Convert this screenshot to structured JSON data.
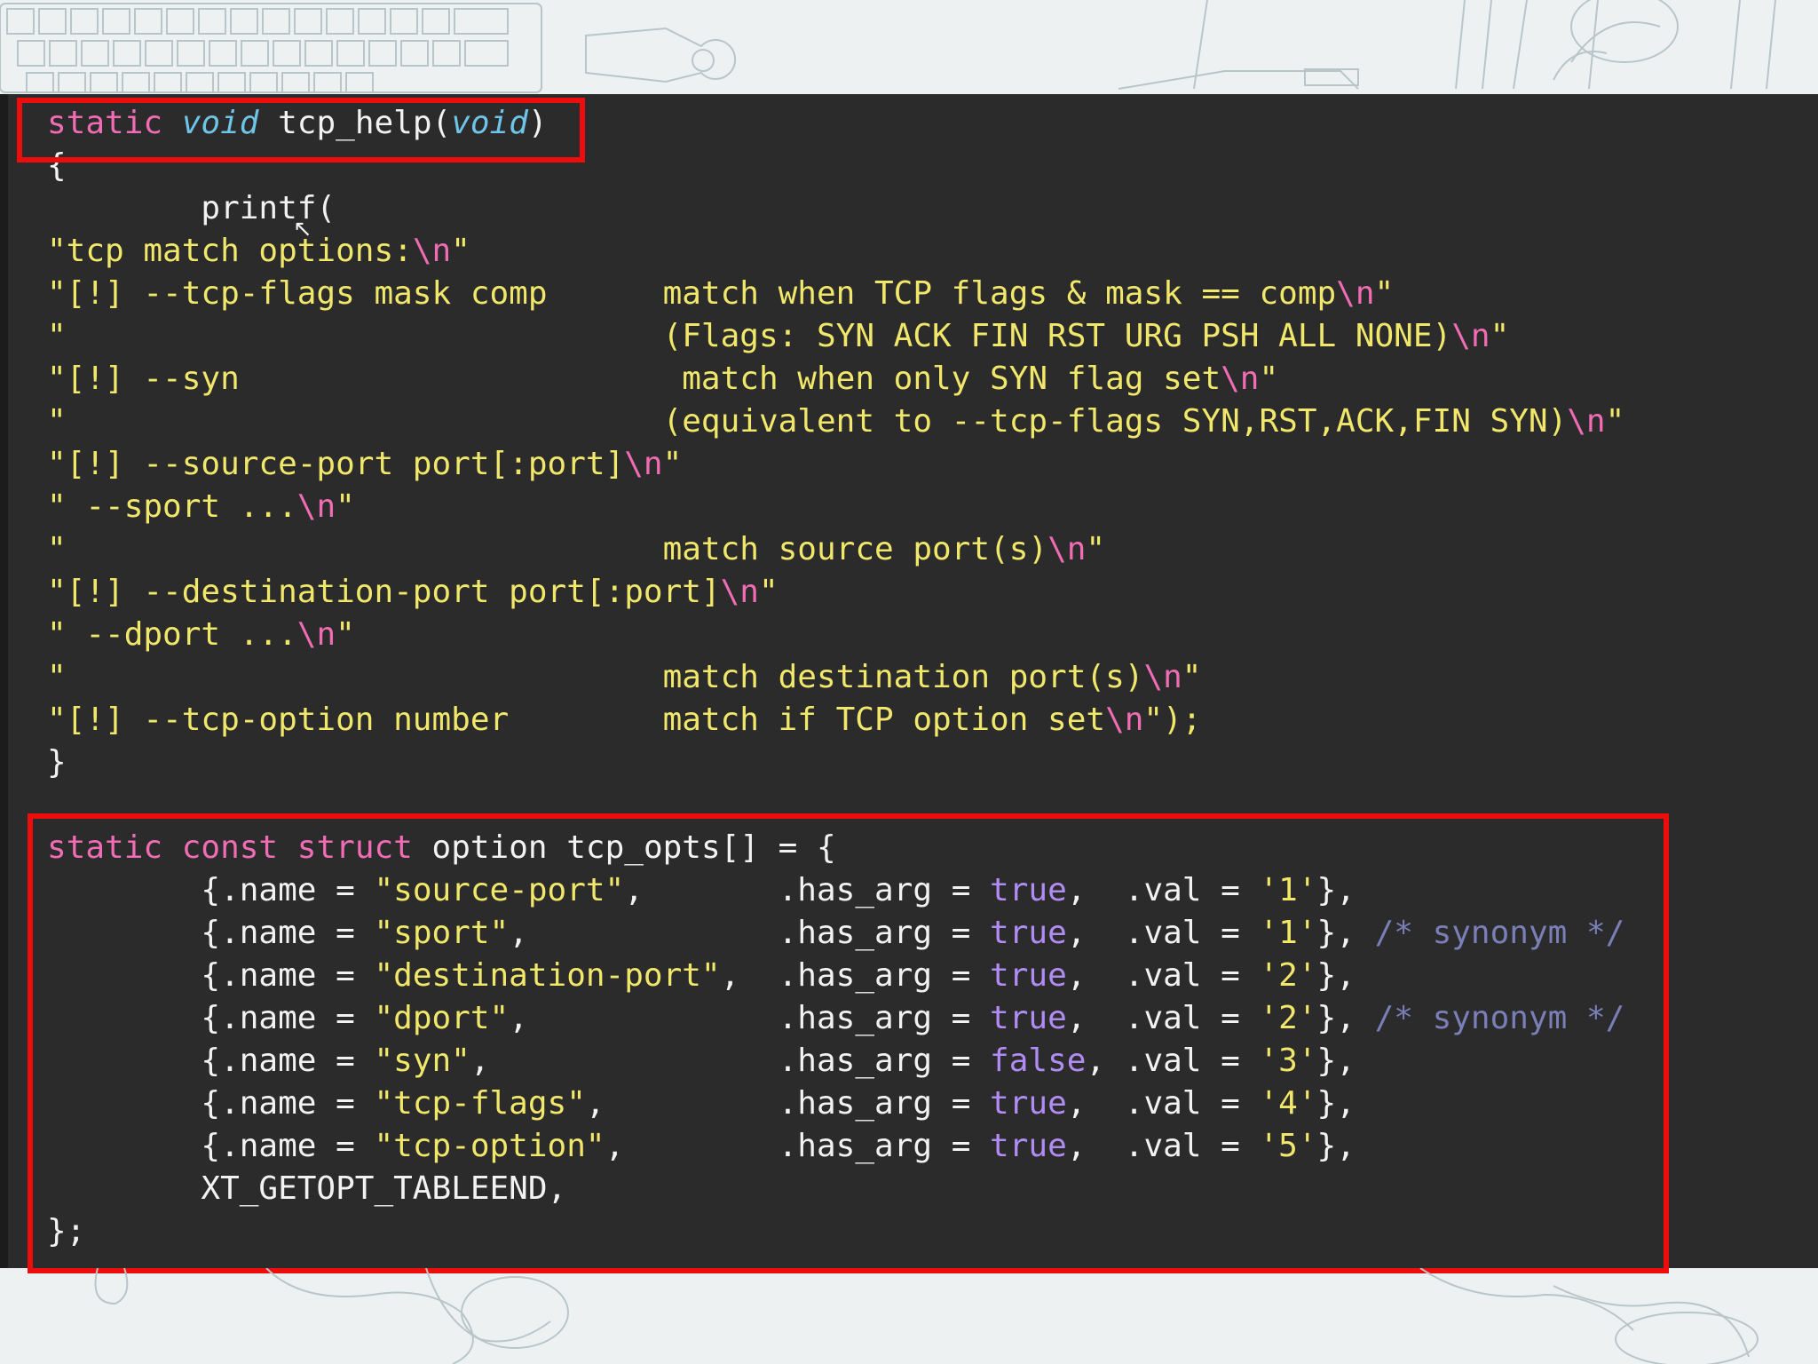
{
  "code": {
    "func_decl": {
      "kw_static": "static",
      "type_void": "void",
      "name": "tcp_help(",
      "param_void": "void",
      "close": ")"
    },
    "brace_open": "{",
    "printf": "printf(",
    "help_lines": [
      {
        "left": "\"tcp match options:",
        "esc": "\\n",
        "end": "\""
      },
      {
        "left": "\"[!] --tcp-flags mask comp",
        "right": "match when TCP flags & mask == comp",
        "esc": "\\n",
        "end": "\""
      },
      {
        "left": "\"",
        "right": "(Flags: SYN ACK FIN RST URG PSH ALL NONE)",
        "esc": "\\n",
        "end": "\""
      },
      {
        "left": "\"[!] --syn",
        "right": "match when only SYN flag set",
        "esc": "\\n",
        "end": "\""
      },
      {
        "left": "\"",
        "right": "(equivalent to --tcp-flags SYN,RST,ACK,FIN SYN)",
        "esc": "\\n",
        "end": "\""
      },
      {
        "left": "\"[!] --source-port port[:port]",
        "esc": "\\n",
        "end": "\""
      },
      {
        "left": "\" --sport ...",
        "esc": "\\n",
        "end": "\""
      },
      {
        "left": "\"",
        "right": "match source port(s)",
        "esc": "\\n",
        "end": "\""
      },
      {
        "left": "\"[!] --destination-port port[:port]",
        "esc": "\\n",
        "end": "\""
      },
      {
        "left": "\" --dport ...",
        "esc": "\\n",
        "end": "\""
      },
      {
        "left": "\"",
        "right": "match destination port(s)",
        "esc": "\\n",
        "end": "\""
      },
      {
        "left": "\"[!] --tcp-option number",
        "right": "match if TCP option set",
        "esc": "\\n",
        "end": "\");"
      }
    ],
    "brace_close": "}",
    "struct_decl": {
      "kw_static": "static",
      "kw_const": "const",
      "kw_struct": "struct",
      "rest": "option tcp_opts[] = {"
    },
    "options": [
      {
        "name": "\"source-port\"",
        "has_arg": "true",
        "val": "'1'",
        "comment": ""
      },
      {
        "name": "\"sport\"",
        "has_arg": "true",
        "val": "'1'",
        "comment": "/* synonym */"
      },
      {
        "name": "\"destination-port\"",
        "has_arg": "true",
        "val": "'2'",
        "comment": ""
      },
      {
        "name": "\"dport\"",
        "has_arg": "true",
        "val": "'2'",
        "comment": "/* synonym */"
      },
      {
        "name": "\"syn\"",
        "has_arg": "false",
        "val": "'3'",
        "comment": ""
      },
      {
        "name": "\"tcp-flags\"",
        "has_arg": "true",
        "val": "'4'",
        "comment": ""
      },
      {
        "name": "\"tcp-option\"",
        "has_arg": "true",
        "val": "'5'",
        "comment": ""
      }
    ],
    "tableend": "XT_GETOPT_TABLEEND,",
    "struct_close": "};"
  },
  "colors": {
    "keyword": "#f06cb4",
    "type": "#6ec5e8",
    "string": "#f1e76a",
    "boolean": "#b28cf5",
    "comment": "#7a7fb8",
    "highlight_box": "#ee0d0d",
    "editor_bg": "#2b2b2b"
  },
  "icons": {
    "cursor": "mouse-cursor-icon"
  }
}
